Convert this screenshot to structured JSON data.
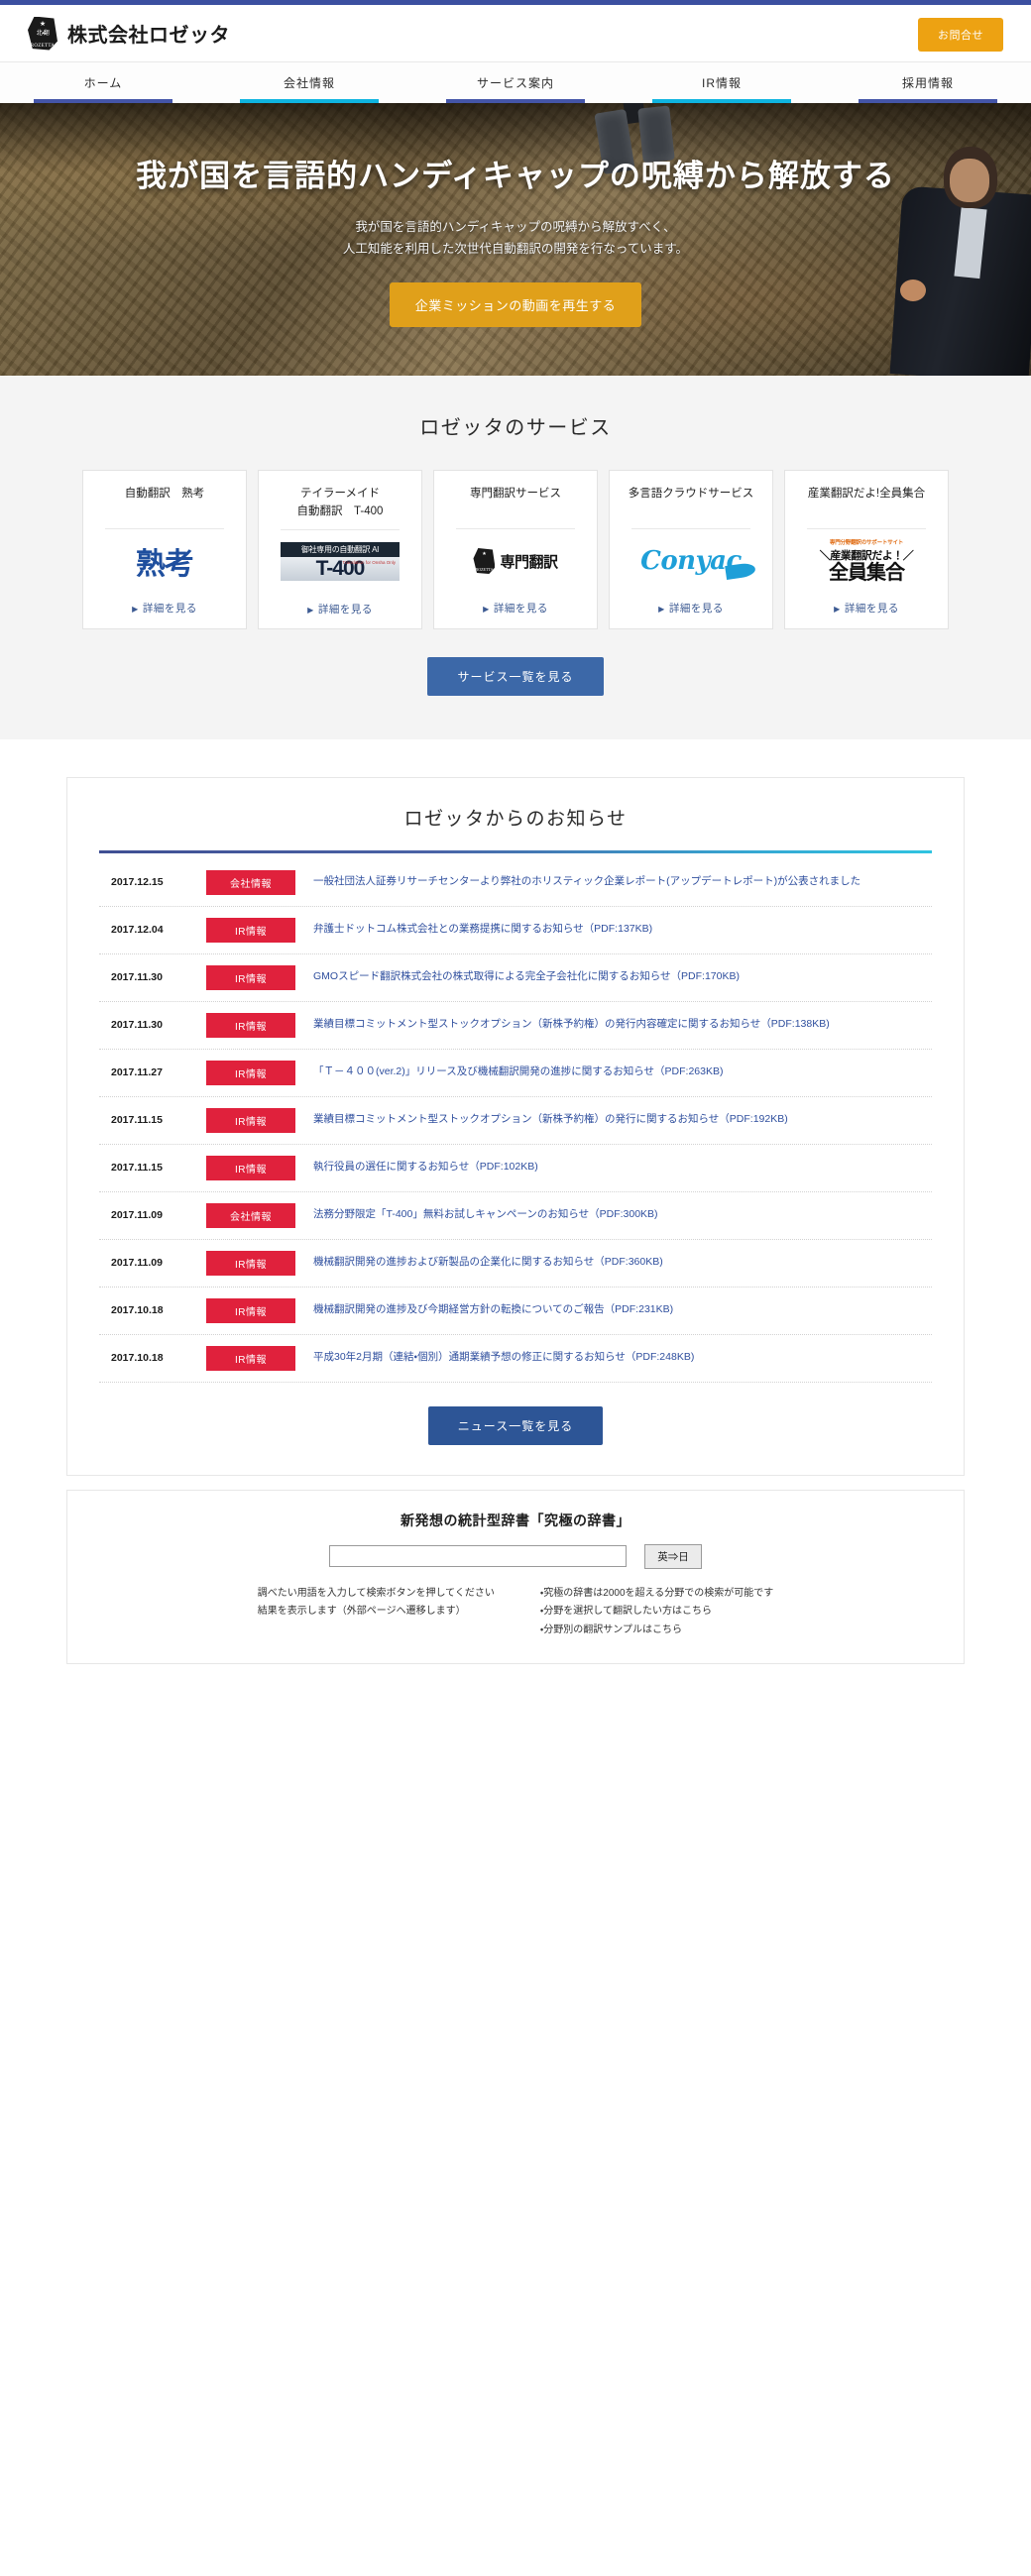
{
  "theme": {
    "accent_navy": "#3b4fa0",
    "accent_cyan": "#0fb4e0",
    "accent_orange": "#eda212",
    "badge_red": "#e0213c",
    "link_blue": "#2f4f9e"
  },
  "header": {
    "brand_name": "株式会社ロゼッタ",
    "logo_star": "★",
    "logo_jp": "北・翻",
    "logo_romaji": "ROZETTA",
    "contact_label": "お問合せ"
  },
  "nav": {
    "items": [
      {
        "label": "ホーム",
        "accent": "c-blue"
      },
      {
        "label": "会社情報",
        "accent": "c-cyan"
      },
      {
        "label": "サービス案内",
        "accent": "c-blue"
      },
      {
        "label": "IR情報",
        "accent": "c-cyan"
      },
      {
        "label": "採用情報",
        "accent": "c-blue"
      }
    ]
  },
  "hero": {
    "title": "我が国を言語的ハンディキャップの呪縛から解放する",
    "sub_line1": "我が国を言語的ハンディキャップの呪縛から解放すべく、",
    "sub_line2": "人工知能を利用した次世代自動翻訳の開発を行なっています。",
    "cta_label": "企業ミッションの動画を再生する"
  },
  "services": {
    "title": "ロゼッタのサービス",
    "link_label": "詳細を見る",
    "link_marker": "▶",
    "all_button": "サービス一覧を見る",
    "cards": [
      {
        "title": "自動翻訳　熟考",
        "logo_kind": "jukko",
        "logo_text": "熟考"
      },
      {
        "title_line1": "テイラーメイド",
        "title_line2": "自動翻訳　T-400",
        "logo_kind": "t400",
        "logo_cap": "御社専用の自動翻訳 AI",
        "logo_big": "T-400",
        "logo_small": "Translation for Onsha Only"
      },
      {
        "title": "専門翻訳サービス",
        "logo_kind": "senmon",
        "logo_text": "専門翻訳",
        "logo_star": "★",
        "logo_romaji": "ROZETTA"
      },
      {
        "title": "多言語クラウドサービス",
        "logo_kind": "conyac",
        "logo_text": "Conyac"
      },
      {
        "title": "産業翻訳だよ!全員集合",
        "logo_kind": "zenin",
        "logo_line1": "専門分野翻訳のサポートサイト",
        "logo_line2": "＼産業翻訳だよ！／",
        "logo_line3": "全員集合"
      }
    ]
  },
  "news": {
    "title": "ロゼッタからのお知らせ",
    "all_button": "ニュース一覧を見る",
    "rows": [
      {
        "date": "2017.12.15",
        "badge": "会社情報",
        "text": "一般社団法人証券リサーチセンターより弊社のホリスティック企業レポート(アップデートレポート)が公表されました"
      },
      {
        "date": "2017.12.04",
        "badge": "IR情報",
        "text": "弁護士ドットコム株式会社との業務提携に関するお知らせ（PDF:137KB)"
      },
      {
        "date": "2017.11.30",
        "badge": "IR情報",
        "text": "GMOスピード翻訳株式会社の株式取得による完全子会社化に関するお知らせ（PDF:170KB)"
      },
      {
        "date": "2017.11.30",
        "badge": "IR情報",
        "text": "業績目標コミットメント型ストックオプション（新株予約権）の発行内容確定に関するお知らせ（PDF:138KB)"
      },
      {
        "date": "2017.11.27",
        "badge": "IR情報",
        "text": "「Ｔ－４００(ver.2)」リリース及び機械翻訳開発の進捗に関するお知らせ（PDF:263KB)"
      },
      {
        "date": "2017.11.15",
        "badge": "IR情報",
        "text": "業績目標コミットメント型ストックオプション（新株予約権）の発行に関するお知らせ（PDF:192KB)"
      },
      {
        "date": "2017.11.15",
        "badge": "IR情報",
        "text": "執行役員の選任に関するお知らせ（PDF:102KB)"
      },
      {
        "date": "2017.11.09",
        "badge": "会社情報",
        "text": "法務分野限定「T-400」無料お試しキャンペーンのお知らせ（PDF:300KB)"
      },
      {
        "date": "2017.11.09",
        "badge": "IR情報",
        "text": "機械翻訳開発の進捗および新製品の企業化に関するお知らせ（PDF:360KB)"
      },
      {
        "date": "2017.10.18",
        "badge": "IR情報",
        "text": "機械翻訳開発の進捗及び今期経営方針の転換についてのご報告（PDF:231KB)"
      },
      {
        "date": "2017.10.18",
        "badge": "IR情報",
        "text": "平成30年2月期（連結・個別）通期業績予想の修正に関するお知らせ（PDF:248KB)"
      }
    ]
  },
  "dictionary": {
    "title": "新発想の統計型辞書「究極の辞書」",
    "input_value": "",
    "input_placeholder": "",
    "go_label": "英⇒日",
    "left_line1": "調べたい用語を入力して検索ボタンを押してください",
    "left_line2": "結果を表示します（外部ページへ遷移します）",
    "right_line1": "・究極の辞書は2000を超える分野での検索が可能です",
    "right_line2": "・分野を選択して翻訳したい方はこちら",
    "right_line3": "・分野別の翻訳サンプルはこちら"
  }
}
